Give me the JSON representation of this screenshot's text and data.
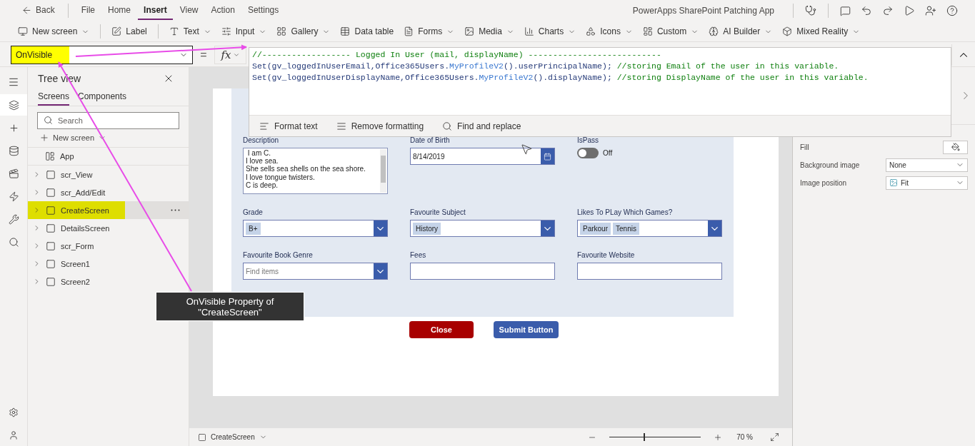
{
  "menu": {
    "back": "Back",
    "items": [
      {
        "label": "File",
        "selected": false
      },
      {
        "label": "Home",
        "selected": false
      },
      {
        "label": "Insert",
        "selected": true
      },
      {
        "label": "View",
        "selected": false
      },
      {
        "label": "Action",
        "selected": false
      },
      {
        "label": "Settings",
        "selected": false
      }
    ],
    "app_title": "PowerApps SharePoint Patching App"
  },
  "ribbon": [
    {
      "label": "New screen",
      "dropdown": true
    },
    {
      "label": "Label",
      "dropdown": false
    },
    {
      "label": "Text",
      "dropdown": true
    },
    {
      "label": "Input",
      "dropdown": true
    },
    {
      "label": "Gallery",
      "dropdown": true
    },
    {
      "label": "Data table",
      "dropdown": false
    },
    {
      "label": "Forms",
      "dropdown": true
    },
    {
      "label": "Media",
      "dropdown": true
    },
    {
      "label": "Charts",
      "dropdown": true
    },
    {
      "label": "Icons",
      "dropdown": true
    },
    {
      "label": "Custom",
      "dropdown": true
    },
    {
      "label": "AI Builder",
      "dropdown": true
    },
    {
      "label": "Mixed Reality",
      "dropdown": true
    }
  ],
  "formula_bar": {
    "property": "OnVisible",
    "equals": "=",
    "fx": "fx",
    "lines": [
      [
        {
          "kind": "comment",
          "text": "//------------------ Logged In User (mail, displayName) ---------------------------"
        }
      ],
      [
        {
          "kind": "plain",
          "text": "Set(gv_loggedInUserEmail,Office365Users."
        },
        {
          "kind": "function",
          "text": "MyProfileV2"
        },
        {
          "kind": "plain",
          "text": "().userPrincipalName); "
        },
        {
          "kind": "comment",
          "text": "//storing Email of the user in this variable."
        }
      ],
      [
        {
          "kind": "plain",
          "text": "Set(gv_loggedInUserDisplayName,Office365Users."
        },
        {
          "kind": "function",
          "text": "MyProfileV2"
        },
        {
          "kind": "plain",
          "text": "().displayName); "
        },
        {
          "kind": "comment",
          "text": "//storing DisplayName of the user in this variable."
        }
      ]
    ],
    "tools": [
      "Format text",
      "Remove formatting",
      "Find and replace"
    ]
  },
  "tree_view": {
    "title": "Tree view",
    "tabs": [
      {
        "label": "Screens",
        "selected": true
      },
      {
        "label": "Components",
        "selected": false
      }
    ],
    "search": {
      "placeholder": "Search"
    },
    "new_screen": "New screen",
    "items": [
      {
        "label": "App",
        "kind": "app",
        "selected": false
      },
      {
        "label": "scr_View",
        "kind": "screen",
        "selected": false
      },
      {
        "label": "scr_Add/Edit",
        "kind": "screen",
        "selected": false
      },
      {
        "label": "CreateScreen",
        "kind": "screen",
        "selected": true
      },
      {
        "label": "DetailsScreen",
        "kind": "screen",
        "selected": false
      },
      {
        "label": "scr_Form",
        "kind": "screen",
        "selected": false
      },
      {
        "label": "Screen1",
        "kind": "screen",
        "selected": false
      },
      {
        "label": "Screen2",
        "kind": "screen",
        "selected": false
      }
    ]
  },
  "form": {
    "rows": [
      [
        {
          "kind": "textarea",
          "label": "Description",
          "lines": [
            " I am C.",
            "I love sea.",
            "She sells sea shells on the sea shore.",
            "I love tongue twisters.",
            "C is deep."
          ]
        },
        {
          "kind": "date",
          "label": "Date of Birth",
          "value": "8/14/2019"
        },
        {
          "kind": "toggle",
          "label": "IsPass",
          "on": false,
          "state_label": "Off"
        }
      ],
      [
        {
          "kind": "combobox",
          "label": "Grade",
          "chips": [
            "B+"
          ]
        },
        {
          "kind": "combobox",
          "label": "Favourite Subject",
          "chips": [
            "History"
          ]
        },
        {
          "kind": "combobox",
          "label": "Likes To PLay Which Games?",
          "chips": [
            "Parkour",
            "Tennis"
          ]
        }
      ],
      [
        {
          "kind": "combobox",
          "label": "Favourite Book Genre",
          "placeholder": "Find items"
        },
        {
          "kind": "text",
          "label": "Fees"
        },
        {
          "kind": "text",
          "label": "Favourite Website"
        }
      ]
    ],
    "buttons": [
      {
        "label": "Close",
        "kind": "danger"
      },
      {
        "label": "Submit Button",
        "kind": "primary"
      }
    ]
  },
  "properties": [
    {
      "label": "Fill",
      "kind": "color"
    },
    {
      "label": "Background image",
      "kind": "select",
      "value": "None"
    },
    {
      "label": "Image position",
      "kind": "select",
      "value": "Fit"
    }
  ],
  "status_bar": {
    "screen": "CreateScreen",
    "zoom": {
      "level": 0.37,
      "reading": "70 %"
    }
  },
  "annotation": {
    "callout": "OnVisible Property of \"CreateScreen\""
  }
}
